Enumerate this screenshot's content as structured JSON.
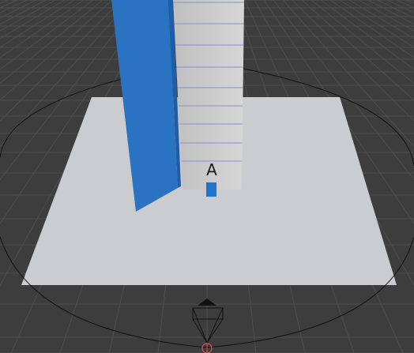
{
  "viewport": {
    "background_color": "#3d3d3d",
    "grid_color": "#4e4e4e"
  },
  "ground_plane": {
    "color": "#cbccd0"
  },
  "tower": {
    "label": "A",
    "block_count": 12,
    "block_color": "#cfcfcf",
    "separator_color": "#7f95d6"
  },
  "blue_wall": {
    "color": "#2a72c2"
  },
  "marker": {
    "color": "#1e75cc"
  },
  "orbit_ring": {
    "color": "#111111"
  },
  "camera_gizmo": {
    "icon": "camera-gizmo-icon",
    "origin_color": "#e05050"
  }
}
